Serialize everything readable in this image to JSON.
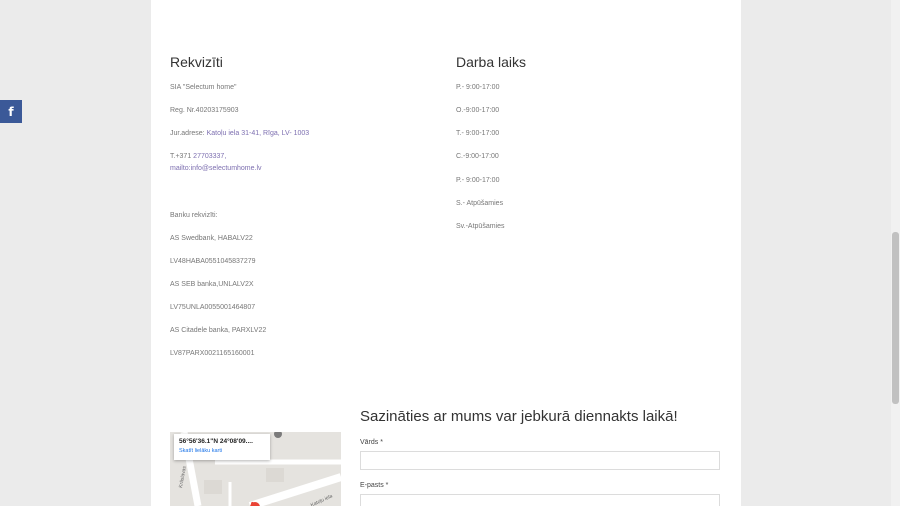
{
  "social": {
    "facebook_glyph": "f"
  },
  "rekviziti": {
    "title": "Rekvizīti",
    "company": "SIA \"Selectum home\"",
    "reg_nr": "Reg. Nr.40203175903",
    "jur_label": "Jur.adrese: ",
    "jur_address": "Katoļu iela 31-41, Rīga, LV- 1003",
    "phone_label": "T.+371 ",
    "phone": "27703337,",
    "email": "mailto:info@selectumhome.lv",
    "bank_title": "Banku rekvizīti:",
    "banks": [
      "AS Swedbank, HABALV22",
      "LV48HABA0551045837279",
      "AS SEB banka,UNLALV2X",
      "LV75UNLA0055001464807",
      "AS Citadele banka, PARXLV22",
      "LV87PARX0021165160001"
    ]
  },
  "darba_laiks": {
    "title": "Darba laiks",
    "hours": [
      "P.- 9:00-17:00",
      "O.-9:00-17:00",
      "T.- 9:00-17:00",
      "C.-9:00-17:00",
      "P.- 9:00-17:00",
      "S.- Atpūšamies",
      "Sv.-Atpūšamies"
    ]
  },
  "contact_form": {
    "title": "Sazināties ar mums var jebkurā diennakts laikā!",
    "name_label": "Vārds *",
    "email_label": "E-pasts *",
    "name_value": "",
    "email_value": ""
  },
  "map": {
    "coords": "56°56'36.1\"N 24°08'09....",
    "link": "Skatīt lielāku karti",
    "streets": [
      "Krāslavas",
      "Katoļu iela"
    ],
    "marker_color": "#ea4335"
  },
  "colors": {
    "link": "#7d6fb0",
    "facebook": "#3b5998"
  }
}
